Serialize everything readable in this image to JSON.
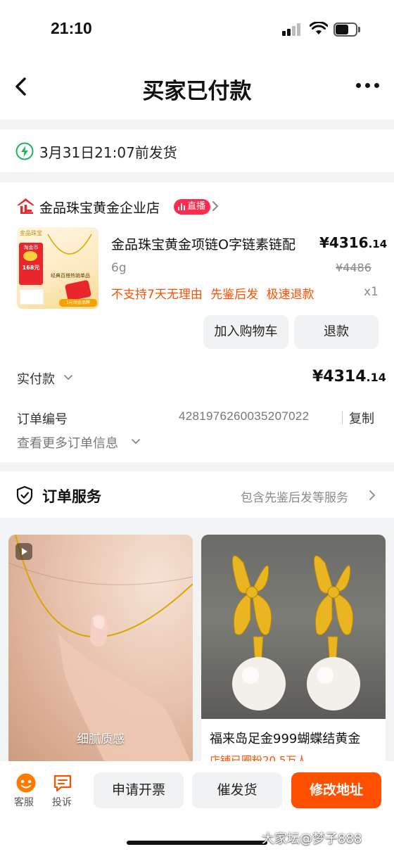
{
  "status_bar": {
    "time": "21:10"
  },
  "nav": {
    "title": "买家已付款"
  },
  "shipping": {
    "deadline_text": "3月31日21:07前发货"
  },
  "shop": {
    "name": "金品珠宝黄金企业店",
    "live_badge": "直播"
  },
  "product": {
    "thumb_header": "金品珠宝",
    "thumb_red_text": "淘金币",
    "thumb_red_price": "168元",
    "thumb_band": "经典百搭热销单品",
    "thumb_foot": "1元领金品牌",
    "title": "金品珠宝黄金项链O字链素链配",
    "price_main": "¥4316",
    "price_decimal": ".14",
    "spec": "6g",
    "original_price": "¥4486",
    "tags": "不支持7天无理由 先鉴后发 极速退款",
    "quantity": "x1",
    "add_cart_label": "加入购物车",
    "refund_label": "退款"
  },
  "payment": {
    "paid_label": "实付款",
    "paid_main": "¥4314",
    "paid_decimal": ".14",
    "order_no_label": "订单编号",
    "order_no": "4281976260035207022",
    "copy_label": "复制",
    "more_info_label": "查看更多订单信息"
  },
  "service": {
    "title": "订单服务",
    "desc": "包含先鉴后发等服务"
  },
  "recommendations": [
    {
      "caption": "细腻质感"
    },
    {
      "name": "福来岛足金999蝴蝶结黄金",
      "fans": "店铺已圈粉20.5万人"
    }
  ],
  "bottom_bar": {
    "kefu_label": "客服",
    "complain_label": "投诉",
    "invoice_label": "申请开票",
    "urge_label": "催发货",
    "address_label": "修改地址"
  },
  "watermark": "大家坛@梦子888",
  "colors": {
    "accent": "#ff5000",
    "live": "#ff2b4e",
    "brand_red": "#e8262b",
    "ship_green": "#1fb35a"
  }
}
